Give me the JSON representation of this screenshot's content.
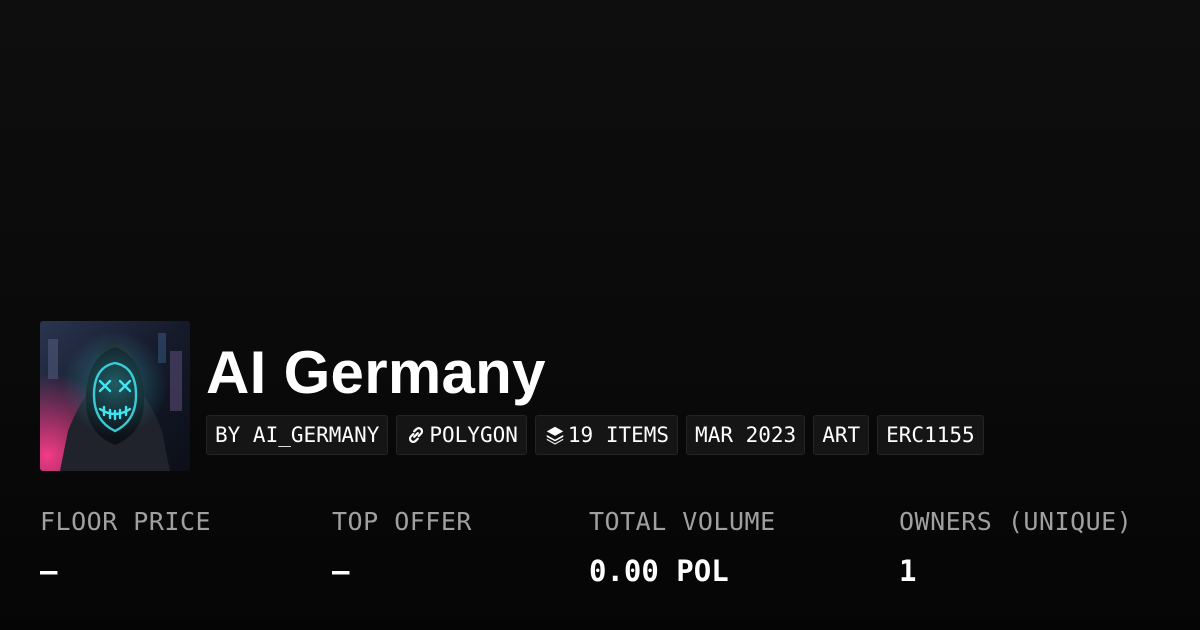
{
  "collection": {
    "name": "AI Germany",
    "avatar": "hooded-figure-neon-mask"
  },
  "tags": [
    {
      "label": "BY AI_GERMANY",
      "icon": ""
    },
    {
      "label": "POLYGON",
      "icon": "link-icon"
    },
    {
      "label": "19 ITEMS",
      "icon": "layers-icon"
    },
    {
      "label": "MAR 2023",
      "icon": ""
    },
    {
      "label": "ART",
      "icon": ""
    },
    {
      "label": "ERC1155",
      "icon": ""
    }
  ],
  "stats": {
    "floor_price": {
      "label": "FLOOR PRICE",
      "value": "–"
    },
    "top_offer": {
      "label": "TOP OFFER",
      "value": "–"
    },
    "total_volume": {
      "label": "TOTAL VOLUME",
      "value": "0.00 POL"
    },
    "owners": {
      "label": "OWNERS (UNIQUE)",
      "value": "1"
    }
  },
  "colors": {
    "background": "#0a0a0a",
    "tag_background": "#151515",
    "tag_border": "#242424",
    "label_gray": "#a0a0a0",
    "text": "#ffffff",
    "mask_neon": "#3fe6f0",
    "avatar_magenta": "#e0407a"
  }
}
